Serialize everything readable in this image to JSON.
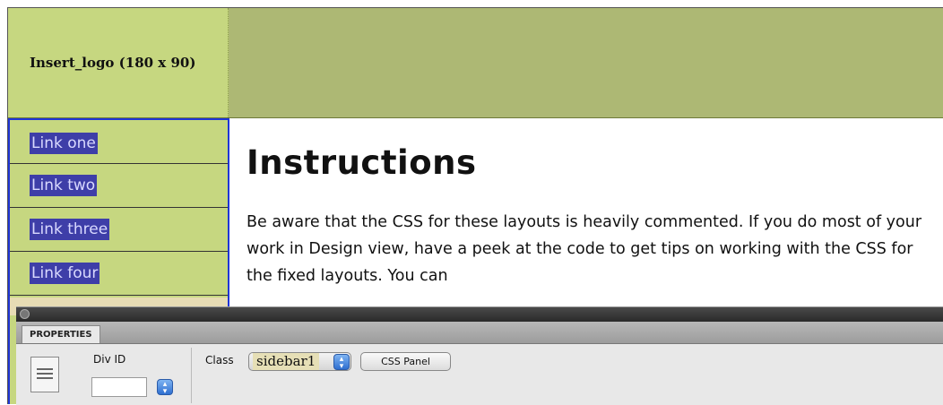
{
  "header": {
    "logo_text": "Insert_logo (180 x 90)"
  },
  "sidebar": {
    "items": [
      {
        "label": "Link one"
      },
      {
        "label": "Link two"
      },
      {
        "label": "Link three"
      },
      {
        "label": "Link four"
      }
    ]
  },
  "content": {
    "heading": "Instructions",
    "paragraph": "Be aware that the CSS for these layouts is heavily commented. If you do most of your work in Design view, have a peek at the code to get tips on working with the CSS for the fixed layouts. You can"
  },
  "properties_panel": {
    "tab_label": "PROPERTIES",
    "div_id_label": "Div ID",
    "div_id_value": "",
    "class_label": "Class",
    "class_value": "sidebar1",
    "css_panel_button": "CSS Panel"
  },
  "colors": {
    "header_logo_bg": "#c6d780",
    "header_band_bg": "#adb874",
    "sidebar_border": "#1f35d6",
    "nav_link_bg": "#3e3ea8"
  }
}
